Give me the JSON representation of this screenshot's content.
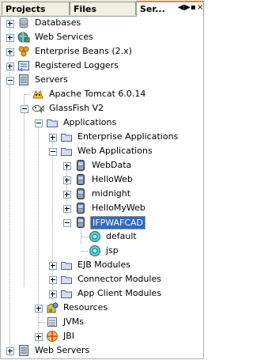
{
  "tabs": [
    {
      "label": "Projects"
    },
    {
      "label": "Files"
    },
    {
      "label": "Ser..."
    }
  ],
  "tab_controls": {
    "left": "◀",
    "right": "▶",
    "pin": "▪",
    "close": "×"
  },
  "tree": [
    {
      "label": "Databases",
      "icon": "database-icon",
      "expanded": false
    },
    {
      "label": "Web Services",
      "icon": "web-services-icon",
      "expanded": false
    },
    {
      "label": "Enterprise Beans (2.x)",
      "icon": "enterprise-beans-icon",
      "expanded": false
    },
    {
      "label": "Registered Loggers",
      "icon": "logger-icon",
      "expanded": false
    },
    {
      "label": "Servers",
      "icon": "servers-icon",
      "expanded": true
    },
    {
      "label": "Apache Tomcat 6.0.14",
      "icon": "tomcat-icon"
    },
    {
      "label": "GlassFish V2",
      "icon": "glassfish-icon",
      "expanded": true
    },
    {
      "label": "Applications",
      "icon": "folder-icon",
      "expanded": true
    },
    {
      "label": "Enterprise Applications",
      "icon": "folder-icon",
      "expanded": false
    },
    {
      "label": "Web Applications",
      "icon": "folder-icon",
      "expanded": true
    },
    {
      "label": "WebData",
      "icon": "webapp-icon",
      "expanded": false
    },
    {
      "label": "HelloWeb",
      "icon": "webapp-icon",
      "expanded": false
    },
    {
      "label": "midnight",
      "icon": "webapp-icon",
      "expanded": false
    },
    {
      "label": "HelloMyWeb",
      "icon": "webapp-icon",
      "expanded": false
    },
    {
      "label": "IFPWAFCAD",
      "icon": "webapp-icon",
      "expanded": true,
      "selected": true
    },
    {
      "label": "default",
      "icon": "servlet-icon"
    },
    {
      "label": "jsp",
      "icon": "servlet-icon"
    },
    {
      "label": "EJB Modules",
      "icon": "folder-icon",
      "expanded": false
    },
    {
      "label": "Connector Modules",
      "icon": "folder-icon",
      "expanded": false
    },
    {
      "label": "App Client Modules",
      "icon": "folder-icon",
      "expanded": false
    },
    {
      "label": "Resources",
      "icon": "resources-icon",
      "expanded": false
    },
    {
      "label": "JVMs",
      "icon": "jvms-icon"
    },
    {
      "label": "JBI",
      "icon": "jbi-icon",
      "expanded": false
    },
    {
      "label": "Web Servers",
      "icon": "web-servers-icon",
      "expanded": false
    }
  ]
}
